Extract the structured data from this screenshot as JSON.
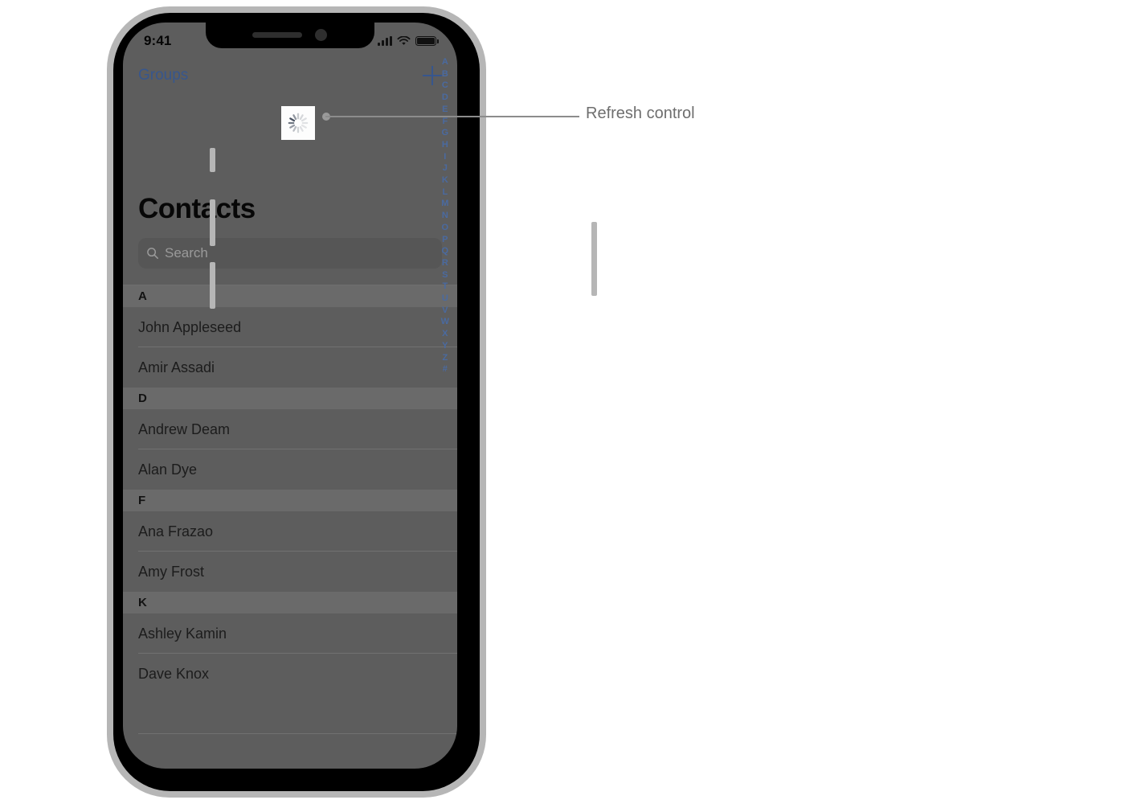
{
  "status_bar": {
    "time": "9:41",
    "cellular_icon": "cellular-bars-icon",
    "wifi_icon": "wifi-icon",
    "battery_icon": "battery-icon"
  },
  "nav_bar": {
    "back_label": "Groups",
    "add_icon": "plus-icon"
  },
  "refresh_control": {
    "spinner_icon": "activity-indicator-icon",
    "spoke_count": 12
  },
  "screen": {
    "title": "Contacts"
  },
  "search": {
    "placeholder": "Search",
    "value": "",
    "icon": "magnifier-icon"
  },
  "list": {
    "sections": [
      {
        "header": "A",
        "rows": [
          "John Appleseed",
          "Amir Assadi"
        ]
      },
      {
        "header": "D",
        "rows": [
          "Andrew Deam",
          "Alan Dye"
        ]
      },
      {
        "header": "F",
        "rows": [
          "Ana Frazao",
          "Amy Frost"
        ]
      },
      {
        "header": "K",
        "rows": [
          "Ashley Kamin",
          "Dave Knox"
        ]
      }
    ]
  },
  "index_bar": {
    "entries": [
      "A",
      "B",
      "C",
      "D",
      "E",
      "F",
      "G",
      "H",
      "I",
      "J",
      "K",
      "L",
      "M",
      "N",
      "O",
      "P",
      "Q",
      "R",
      "S",
      "T",
      "U",
      "V",
      "W",
      "X",
      "Y",
      "Z",
      "#"
    ]
  },
  "callout": {
    "label": "Refresh control"
  },
  "colors": {
    "screen_background": "#5d5d5d",
    "section_header_background": "#6a6a6a",
    "search_field_background": "#565656",
    "accent_blue": "#37568d",
    "index_blue": "#4a6aa0",
    "callout_gray": "#6e6e6e",
    "device_bezel": "#b6b6b6",
    "device_frame": "#000000",
    "spinner_background": "#fdfdfd"
  }
}
